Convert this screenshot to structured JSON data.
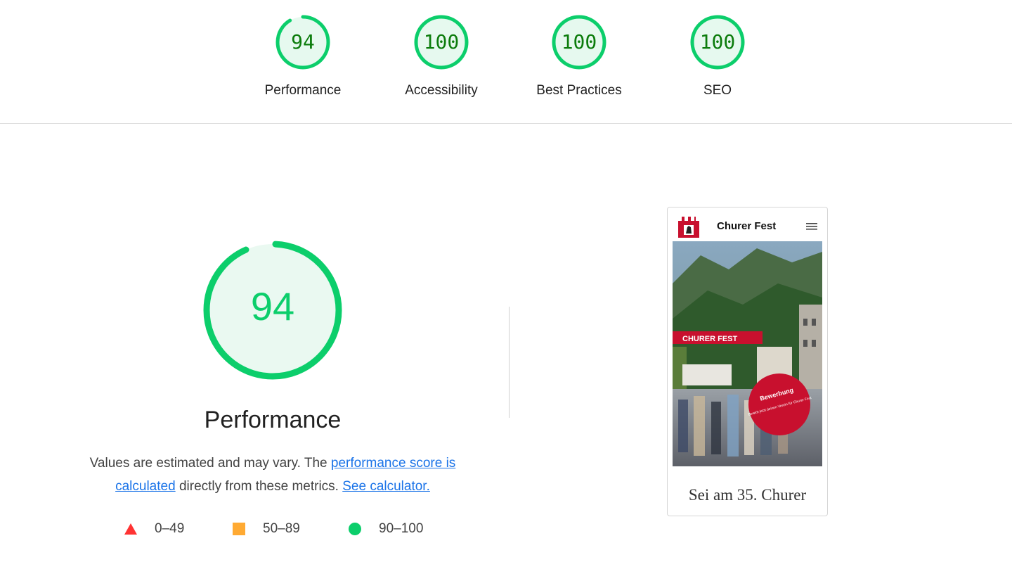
{
  "categories": [
    {
      "label": "Performance",
      "score": "94",
      "value": 94
    },
    {
      "label": "Accessibility",
      "score": "100",
      "value": 100
    },
    {
      "label": "Best Practices",
      "score": "100",
      "value": 100
    },
    {
      "label": "SEO",
      "score": "100",
      "value": 100
    }
  ],
  "main": {
    "score": "94",
    "value": 94,
    "title": "Performance",
    "desc_prefix": "Values are estimated and may vary. The ",
    "desc_link1": "performance score is calculated",
    "desc_mid": " directly from these metrics. ",
    "desc_link2": "See calculator."
  },
  "legend": [
    {
      "range": "0–49",
      "shape": "triangle-icon",
      "color": "#ff3333"
    },
    {
      "range": "50–89",
      "shape": "square-icon",
      "color": "#ffaa33"
    },
    {
      "range": "90–100",
      "shape": "circle-icon",
      "color": "#0cce6b"
    }
  ],
  "screenshot": {
    "site_title": "Churer Fest",
    "hero_badge_title": "Bewerbung",
    "hero_badge_text": "Bewirb jetzt deinen Verein für Churer Fest",
    "banner_text": "CHURER FEST",
    "caption": "Sei am 35. Churer"
  },
  "colors": {
    "pass": "#0cce6b",
    "pass_fill": "#e6f9ef",
    "pass_text": "#0c7c0c",
    "link": "#1a73e8"
  }
}
